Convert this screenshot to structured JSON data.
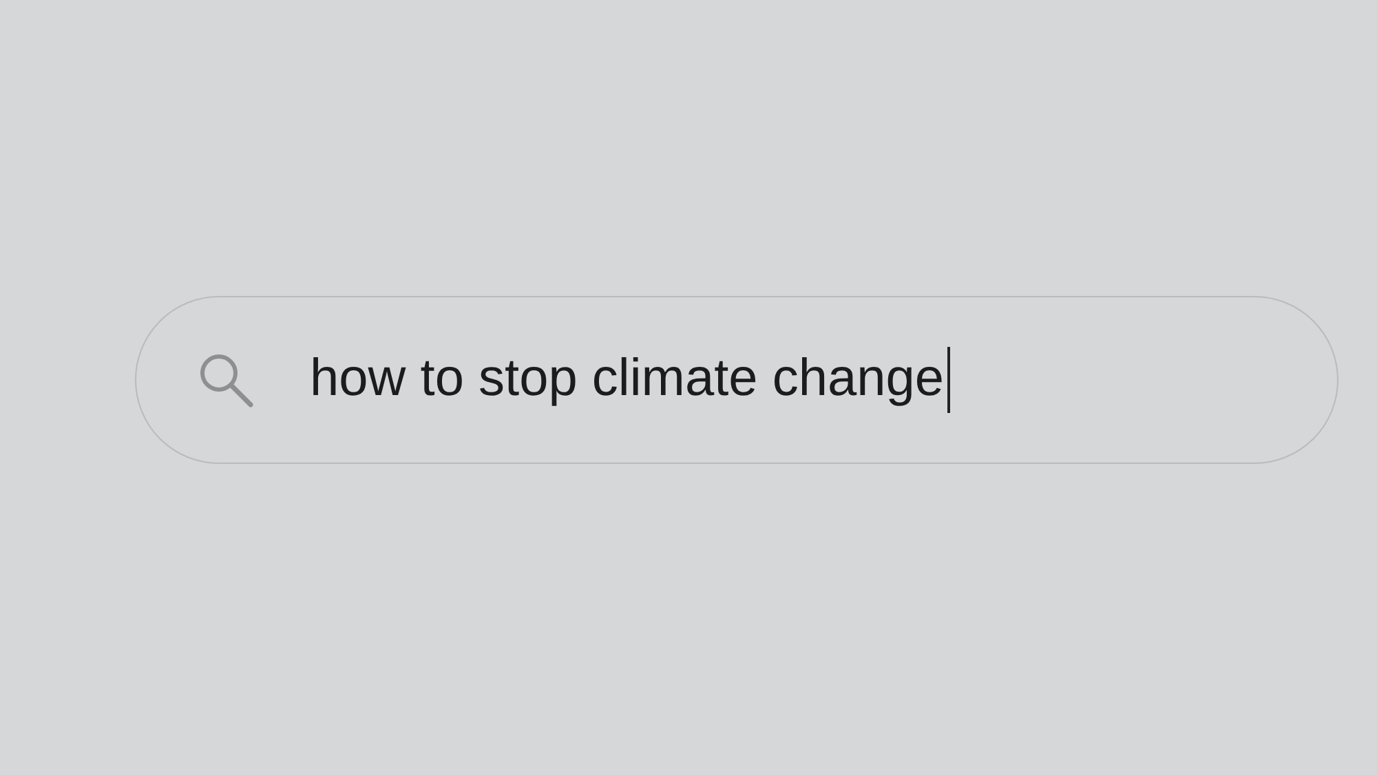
{
  "search": {
    "value": "how to stop climate change",
    "focused": true
  }
}
